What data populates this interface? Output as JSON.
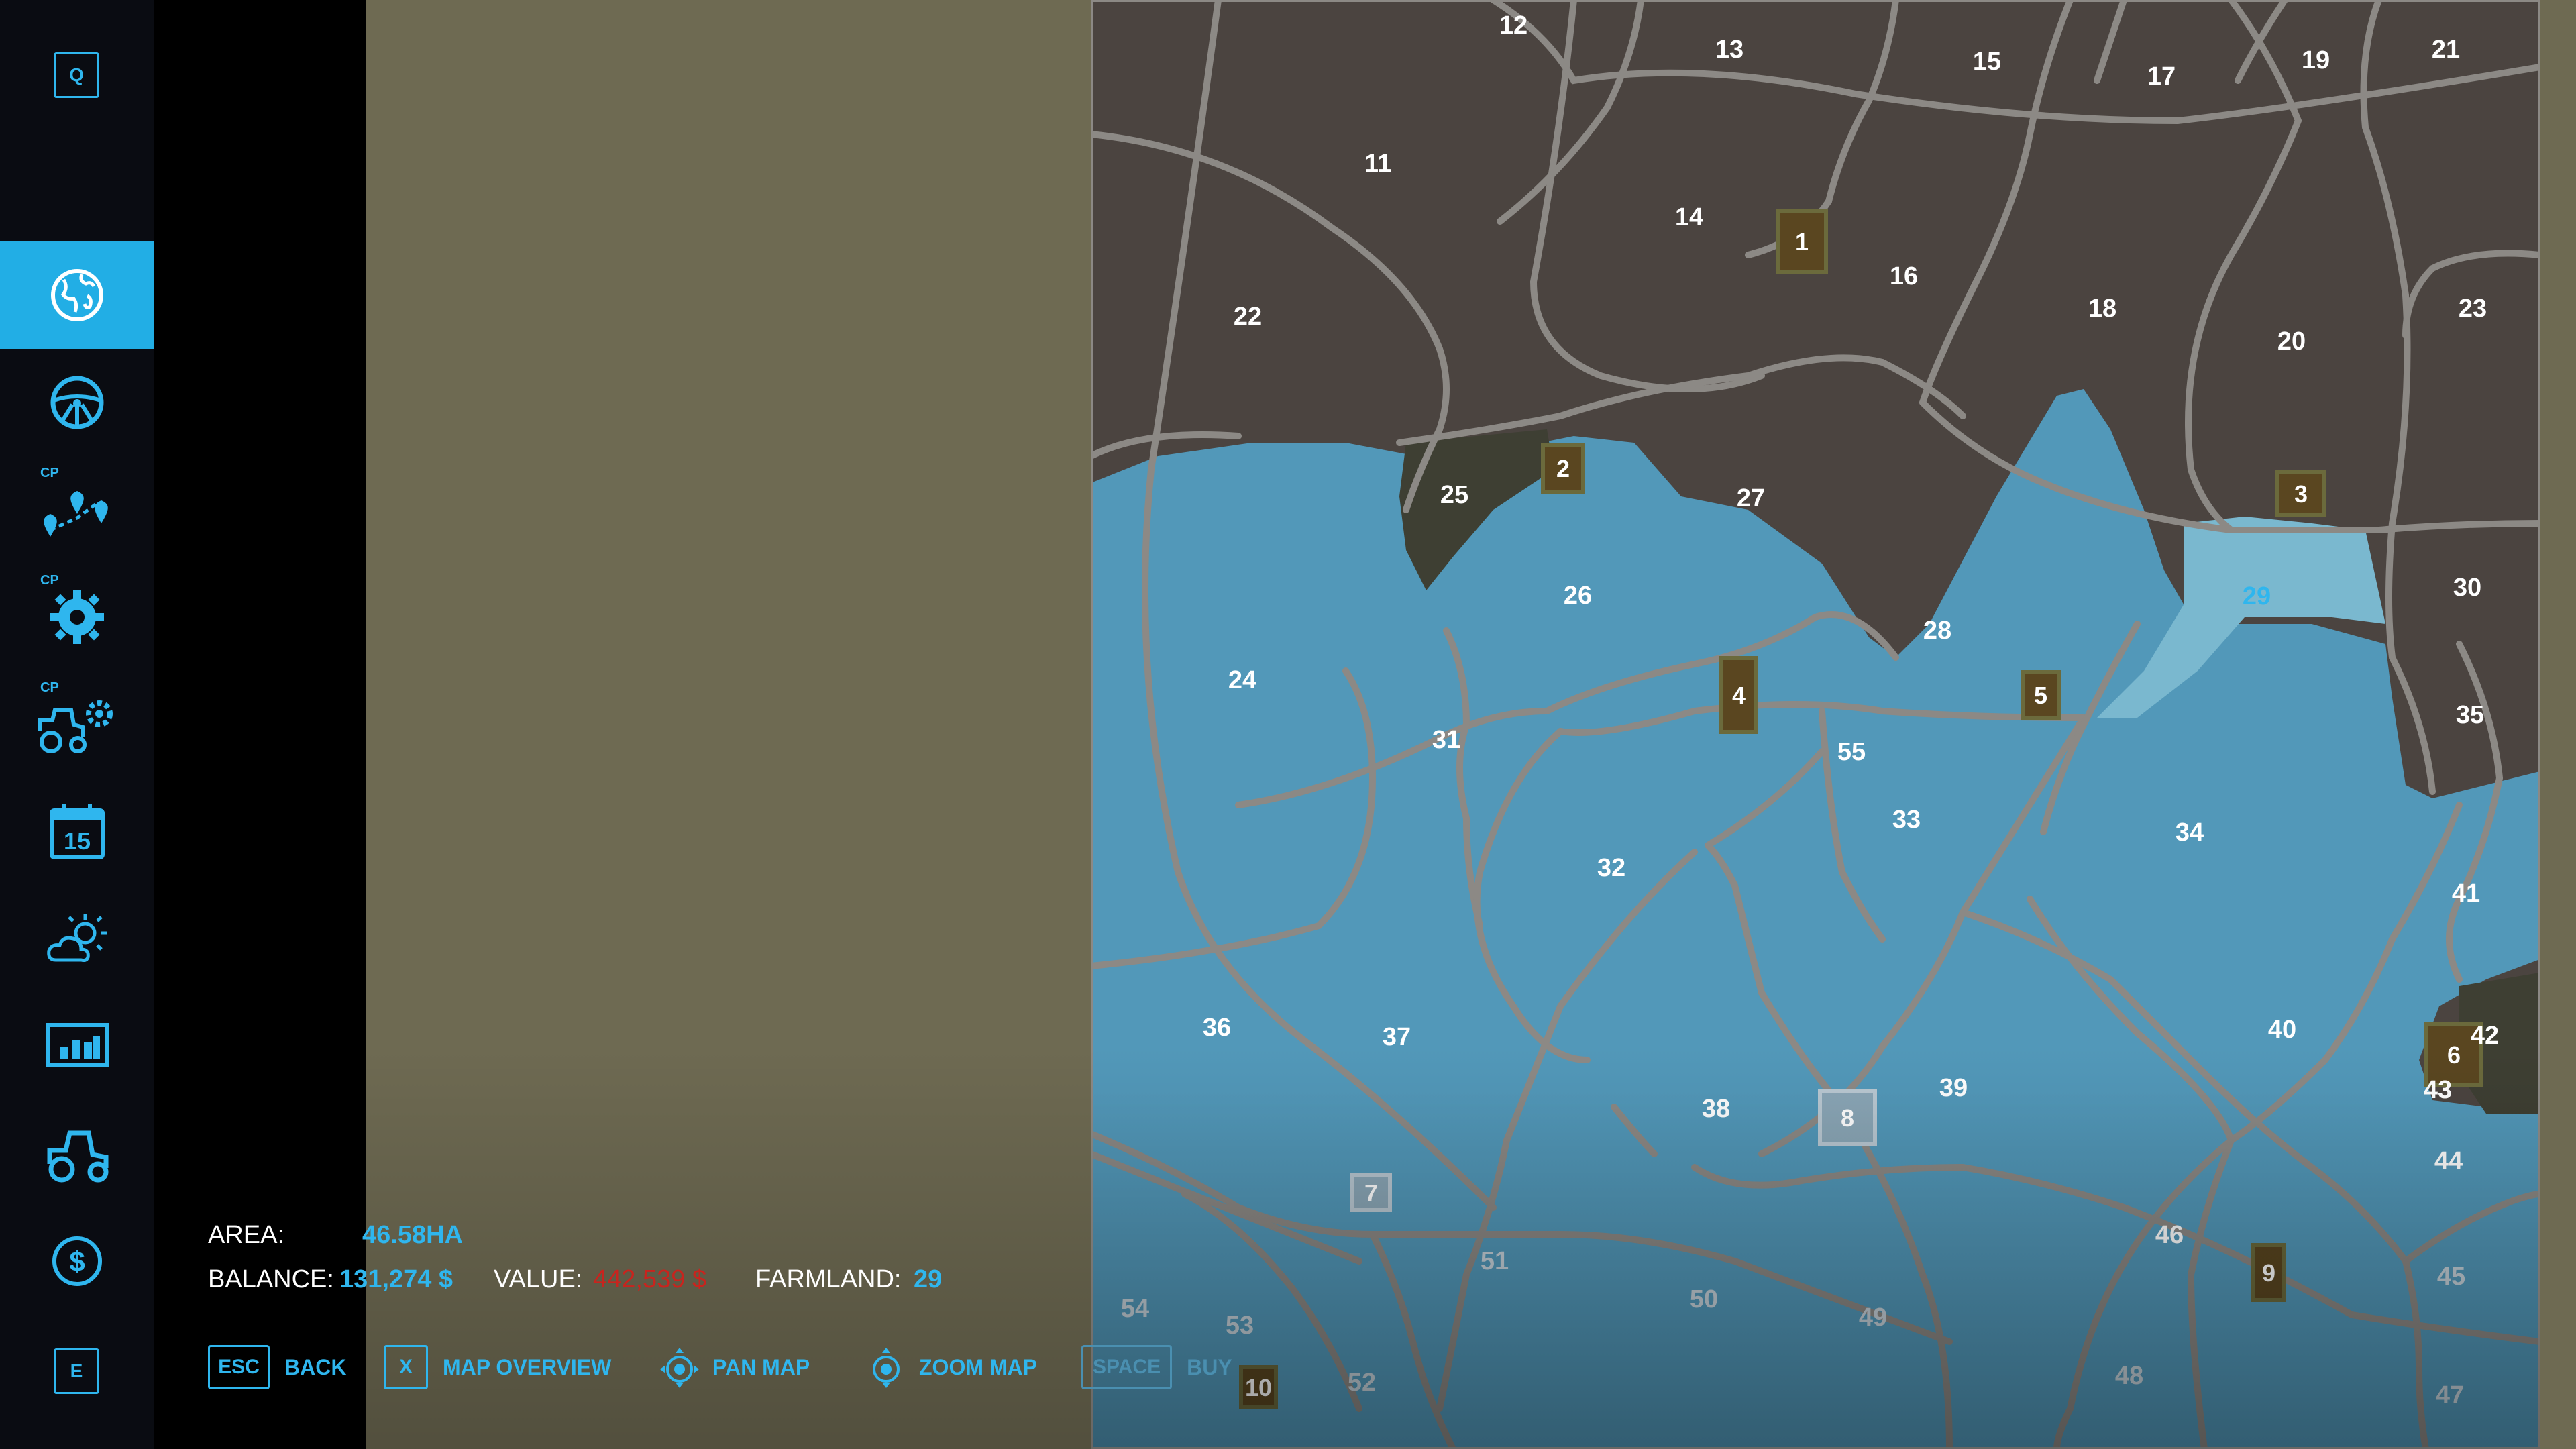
{
  "sidebar": {
    "top_key": "Q",
    "bottom_key": "E",
    "cp_label": "CP",
    "calendar_day": "15",
    "items": [
      {
        "name": "map",
        "icon": "globe-icon",
        "active": true
      },
      {
        "name": "vehicles",
        "icon": "steering-wheel-icon",
        "active": false
      },
      {
        "name": "courseplay-routes",
        "icon": "route-pins-icon",
        "active": false,
        "cp": true
      },
      {
        "name": "courseplay-settings",
        "icon": "gear-icon",
        "active": false,
        "cp": true
      },
      {
        "name": "courseplay-vehicles",
        "icon": "tractor-gear-icon",
        "active": false,
        "cp": true
      },
      {
        "name": "calendar",
        "icon": "calendar-icon",
        "active": false
      },
      {
        "name": "weather",
        "icon": "weather-icon",
        "active": false
      },
      {
        "name": "statistics",
        "icon": "chart-icon",
        "active": false
      },
      {
        "name": "garage",
        "icon": "tractor-icon",
        "active": false
      },
      {
        "name": "finances",
        "icon": "dollar-icon",
        "active": false
      }
    ]
  },
  "info": {
    "area_label": "AREA:",
    "area_value": "46.58HA",
    "balance_label": "BALANCE:",
    "balance_value": "131,274 $",
    "value_label": "VALUE:",
    "value_value": "442,539 $",
    "farmland_label": "FARMLAND:",
    "farmland_value": "29"
  },
  "controls": {
    "back_key": "ESC",
    "back_label": "BACK",
    "overview_key": "X",
    "overview_label": "MAP OVERVIEW",
    "pan_label": "PAN MAP",
    "zoom_label": "ZOOM MAP",
    "buy_key": "SPACE",
    "buy_label": "BUY"
  },
  "map": {
    "selected_field": "29",
    "colors": {
      "owned": "#4b4440",
      "available": "#5298b9",
      "selected": "#7ab8cf",
      "road": "#8c8985",
      "building": "#5a4620",
      "label": "#ffffff",
      "selected_label": "#2fb6ee"
    },
    "field_labels": [
      "11",
      "12",
      "13",
      "14",
      "15",
      "16",
      "17",
      "18",
      "19",
      "20",
      "21",
      "22",
      "23",
      "24",
      "25",
      "26",
      "27",
      "28",
      "29",
      "30",
      "31",
      "32",
      "33",
      "34",
      "35",
      "36",
      "37",
      "38",
      "39",
      "40",
      "41",
      "42",
      "43",
      "44",
      "45",
      "46",
      "47",
      "48",
      "49",
      "50",
      "51",
      "52",
      "53",
      "54",
      "55"
    ],
    "farm_markers": [
      "1",
      "2",
      "3",
      "4",
      "5",
      "6",
      "7",
      "8",
      "9",
      "10"
    ]
  }
}
